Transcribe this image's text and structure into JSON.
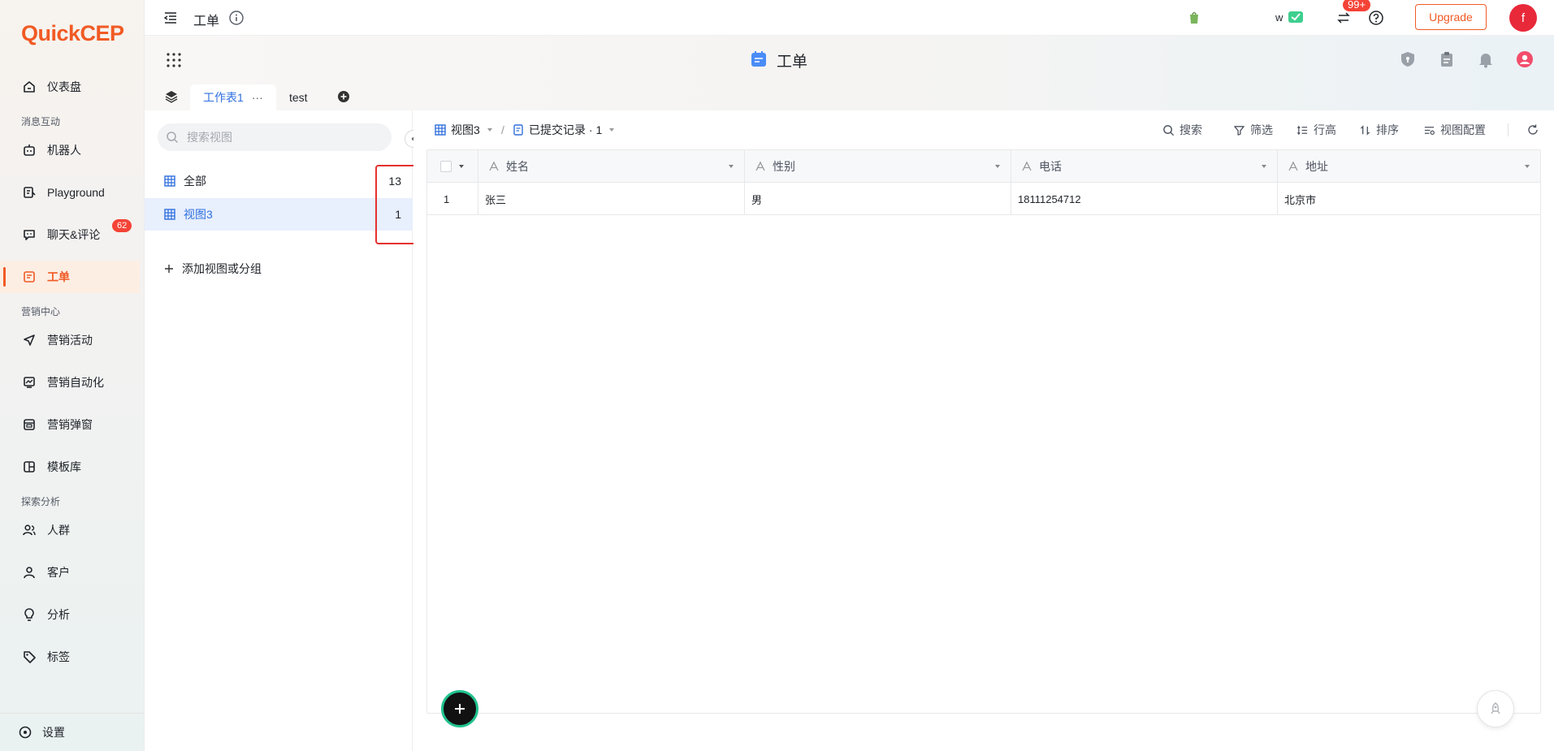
{
  "colors": {
    "brand": "#f15a24",
    "accent_blue": "#2f6fde",
    "alert": "#e5312e"
  },
  "sidebar": {
    "logo": "QuickCEP",
    "items": [
      {
        "label": "仪表盘",
        "icon": "home-icon"
      },
      {
        "label": "机器人",
        "icon": "robot-icon"
      },
      {
        "label": "Playground",
        "icon": "playground-icon"
      },
      {
        "label": "聊天&评论",
        "icon": "chat-icon",
        "badge": "62"
      },
      {
        "label": "工单",
        "icon": "ticket-icon",
        "active": true
      },
      {
        "label": "营销活动",
        "icon": "send-icon"
      },
      {
        "label": "营销自动化",
        "icon": "automation-icon"
      },
      {
        "label": "营销弹窗",
        "icon": "popup-icon"
      },
      {
        "label": "模板库",
        "icon": "template-icon"
      },
      {
        "label": "人群",
        "icon": "people-icon"
      },
      {
        "label": "客户",
        "icon": "user-icon"
      },
      {
        "label": "分析",
        "icon": "bulb-icon"
      },
      {
        "label": "标签",
        "icon": "tag-icon"
      }
    ],
    "sections": [
      "消息互动",
      "营销中心",
      "探索分析"
    ],
    "settings_label": "设置"
  },
  "topbar": {
    "page_title": "工单",
    "store_initial": "w",
    "notification_badge": "99+",
    "upgrade_label": "Upgrade",
    "avatar_letter": "f"
  },
  "header": {
    "title": "工单",
    "tabs": [
      "工作表1",
      "test"
    ],
    "tab_more": "···"
  },
  "viewpanel": {
    "search_placeholder": "搜索视图",
    "views": [
      {
        "label": "全部",
        "count": "13"
      },
      {
        "label": "视图3",
        "count": "1",
        "selected": true
      }
    ],
    "add_label": "添加视图或分组"
  },
  "toolbar": {
    "view_name": "视图3",
    "separator": "/",
    "record_label": "已提交记录 · 1",
    "search_label": "搜索",
    "filter_label": "筛选",
    "row_height_label": "行高",
    "sort_label": "排序",
    "view_config_label": "视图配置"
  },
  "table": {
    "columns": [
      "姓名",
      "性别",
      "电话",
      "地址"
    ],
    "rows": [
      {
        "index": "1",
        "cells": [
          "张三",
          "男",
          "18111254712",
          "北京市"
        ]
      }
    ]
  }
}
